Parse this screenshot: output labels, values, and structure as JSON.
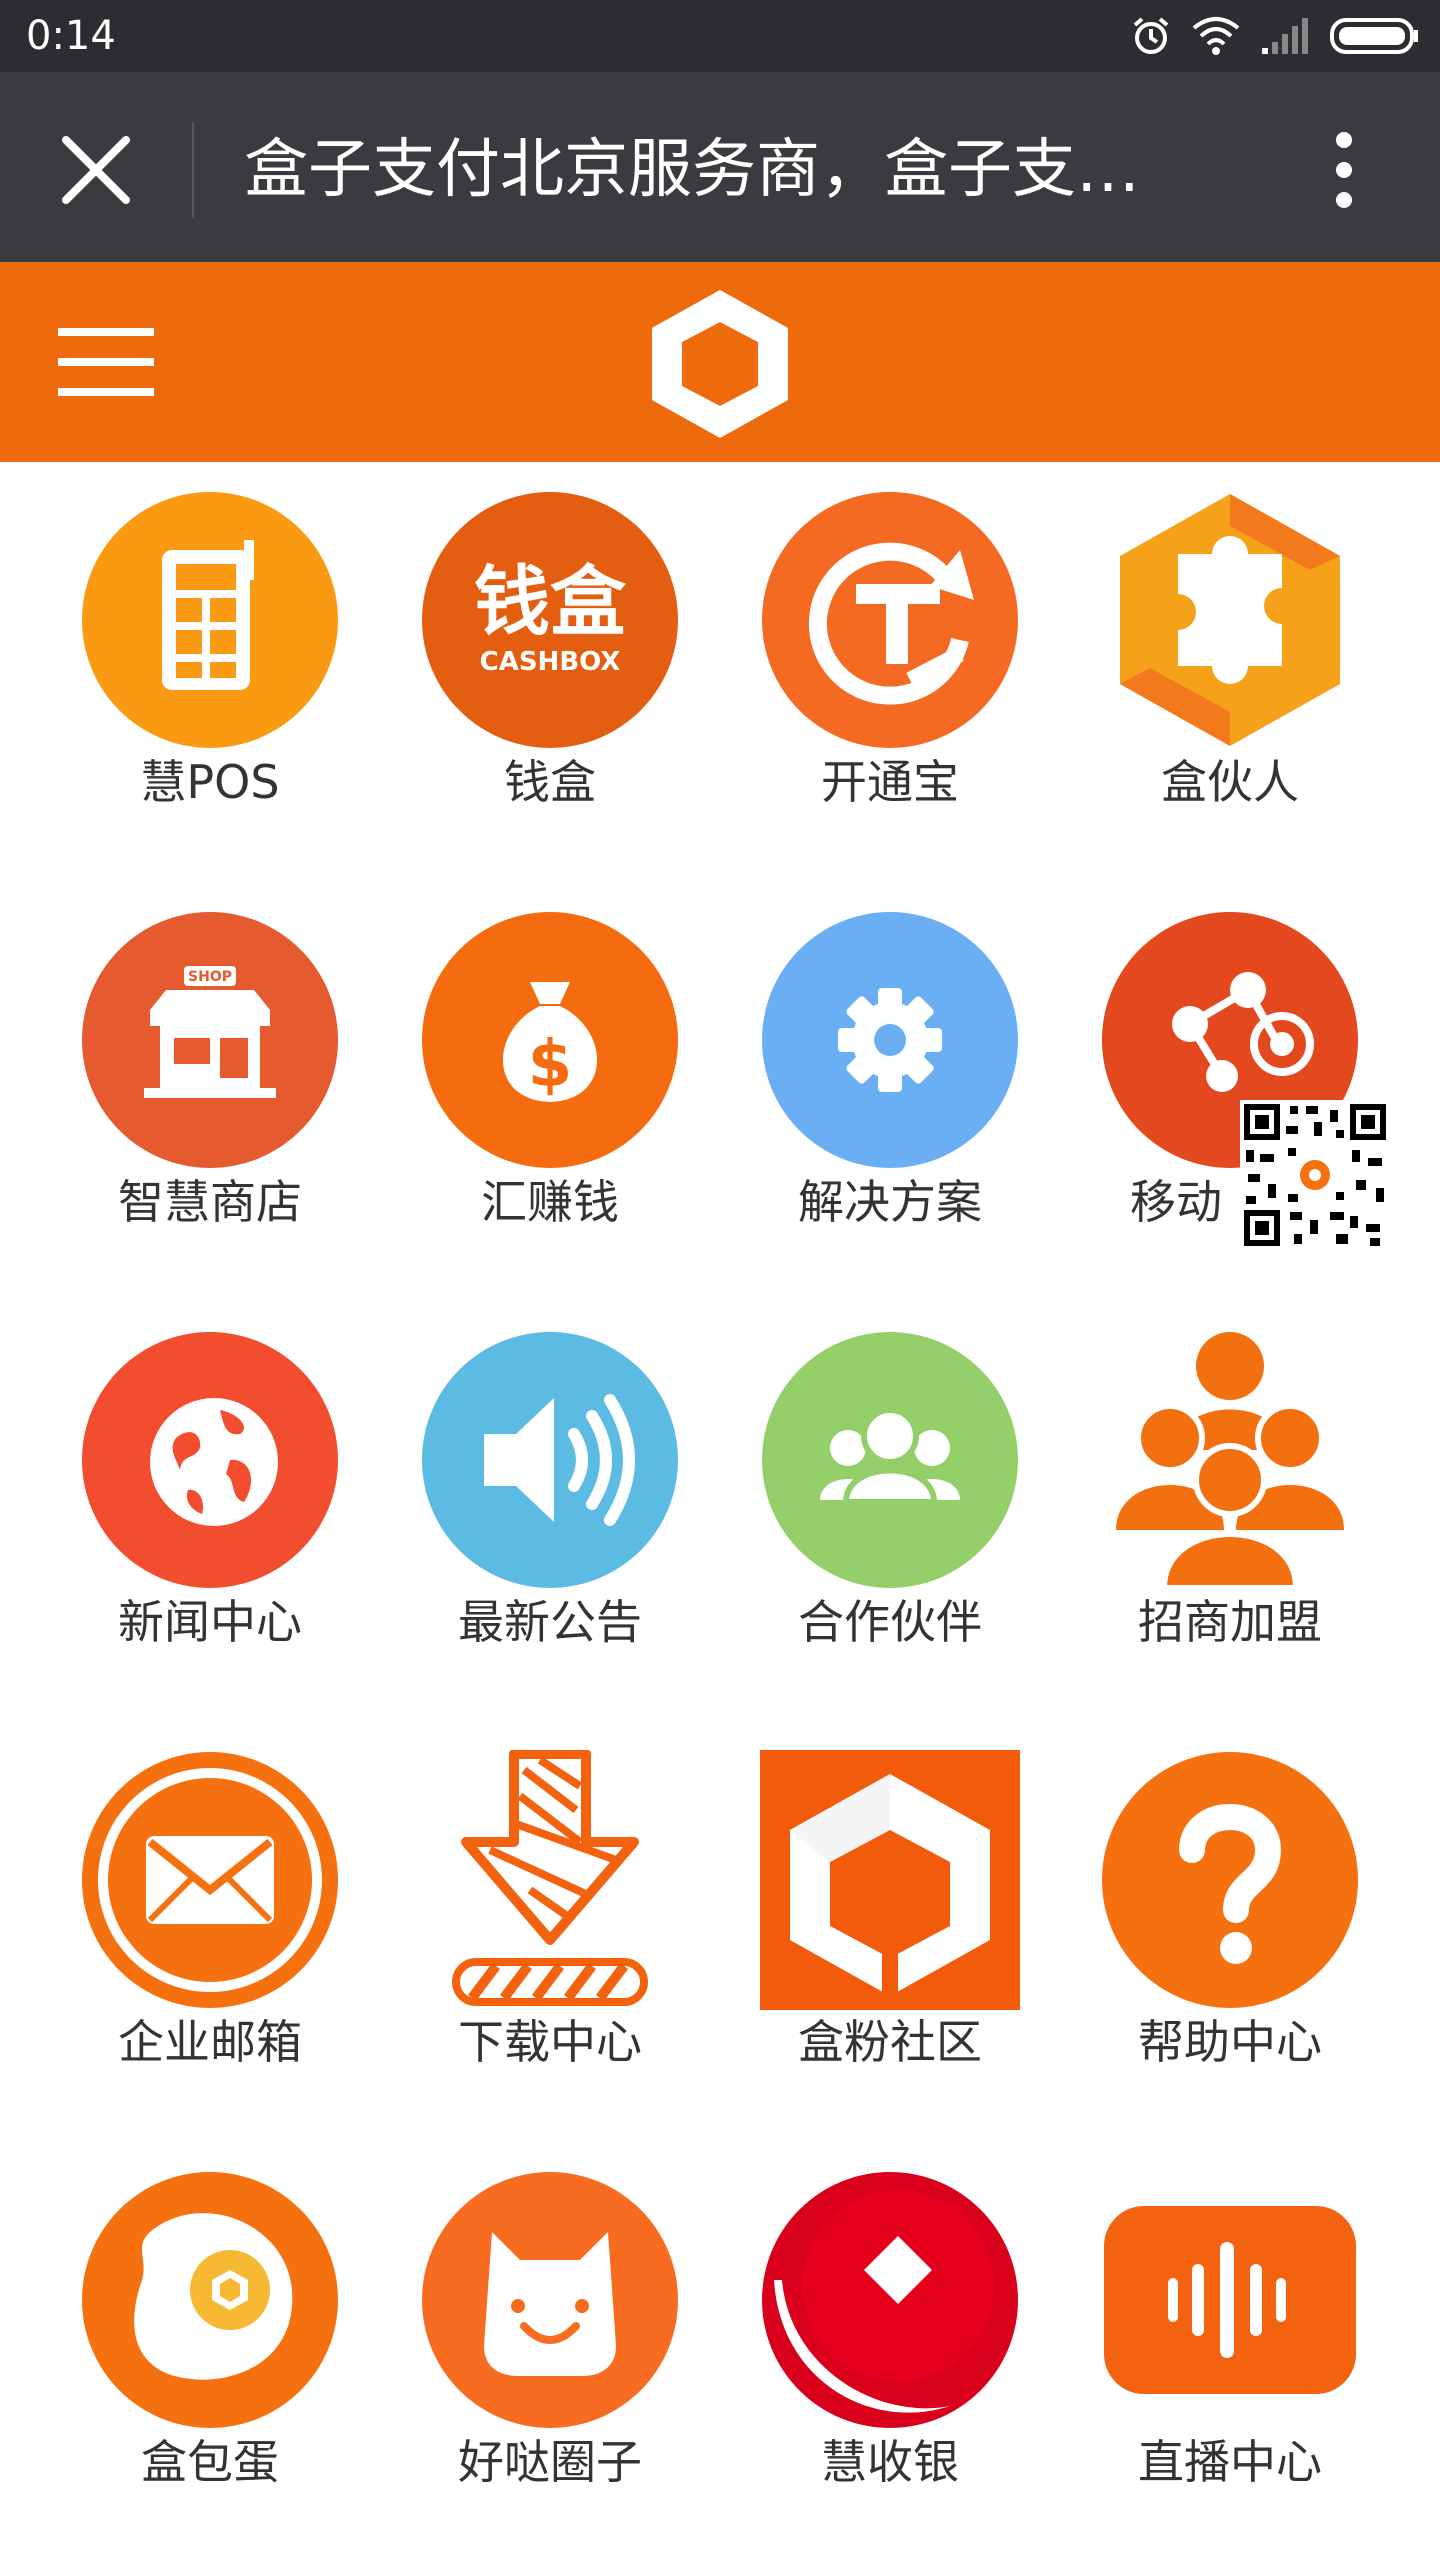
{
  "status_bar": {
    "time": "0:14",
    "icons": [
      "alarm-icon",
      "wifi-icon",
      "signal-icon",
      "battery-icon"
    ]
  },
  "title_bar": {
    "title": "盒子支付北京服务商，盒子支…",
    "close_icon": "close-icon",
    "more_icon": "more-vertical-icon"
  },
  "header": {
    "menu_icon": "hamburger-menu-icon",
    "logo_icon": "box-logo-icon",
    "brand_color": "#ee6b0d"
  },
  "grid": {
    "items": [
      {
        "label": "慧POS",
        "icon": "pos-terminal-icon",
        "color": "#f99a12"
      },
      {
        "label": "钱盒",
        "icon": "cashbox-icon",
        "color": "#e45e11",
        "logo_line1": "钱盒",
        "logo_line2": "CASHBOX"
      },
      {
        "label": "开通宝",
        "icon": "kaitongbao-icon",
        "color": "#f46a22"
      },
      {
        "label": "盒伙人",
        "icon": "puzzle-hexagon-icon",
        "color": "#f5a21a"
      },
      {
        "label": "智慧商店",
        "icon": "shop-icon",
        "color": "#e55a2f",
        "sign": "SHOP"
      },
      {
        "label": "汇赚钱",
        "icon": "money-bag-icon",
        "color": "#f56b10"
      },
      {
        "label": "解决方案",
        "icon": "gear-icon",
        "color": "#6aaef3"
      },
      {
        "label": "移动",
        "icon": "share-network-icon",
        "color": "#e3481e"
      },
      {
        "label": "新闻中心",
        "icon": "globe-icon",
        "color": "#f24d2e"
      },
      {
        "label": "最新公告",
        "icon": "speaker-icon",
        "color": "#5bbbe3"
      },
      {
        "label": "合作伙伴",
        "icon": "people-group-icon",
        "color": "#94cf6a"
      },
      {
        "label": "招商加盟",
        "icon": "people-pyramid-icon",
        "color": "#f2700f"
      },
      {
        "label": "企业邮箱",
        "icon": "mail-icon",
        "color": "#f5700f"
      },
      {
        "label": "下载中心",
        "icon": "download-arrow-icon",
        "color": "#f2620f"
      },
      {
        "label": "盒粉社区",
        "icon": "box-community-icon",
        "color": "#f25a0c"
      },
      {
        "label": "帮助中心",
        "icon": "help-question-icon",
        "color": "#f5700f"
      },
      {
        "label": "盒包蛋",
        "icon": "fried-egg-icon",
        "color": "#f5700f"
      },
      {
        "label": "好哒圈子",
        "icon": "smile-face-icon",
        "color": "#f76c20"
      },
      {
        "label": "慧收银",
        "icon": "red-envelope-icon",
        "color": "#d9001b"
      },
      {
        "label": "直播中心",
        "icon": "live-audio-icon",
        "color": "#f2620f"
      }
    ]
  },
  "qr_code": {
    "icon": "qr-code-icon"
  }
}
